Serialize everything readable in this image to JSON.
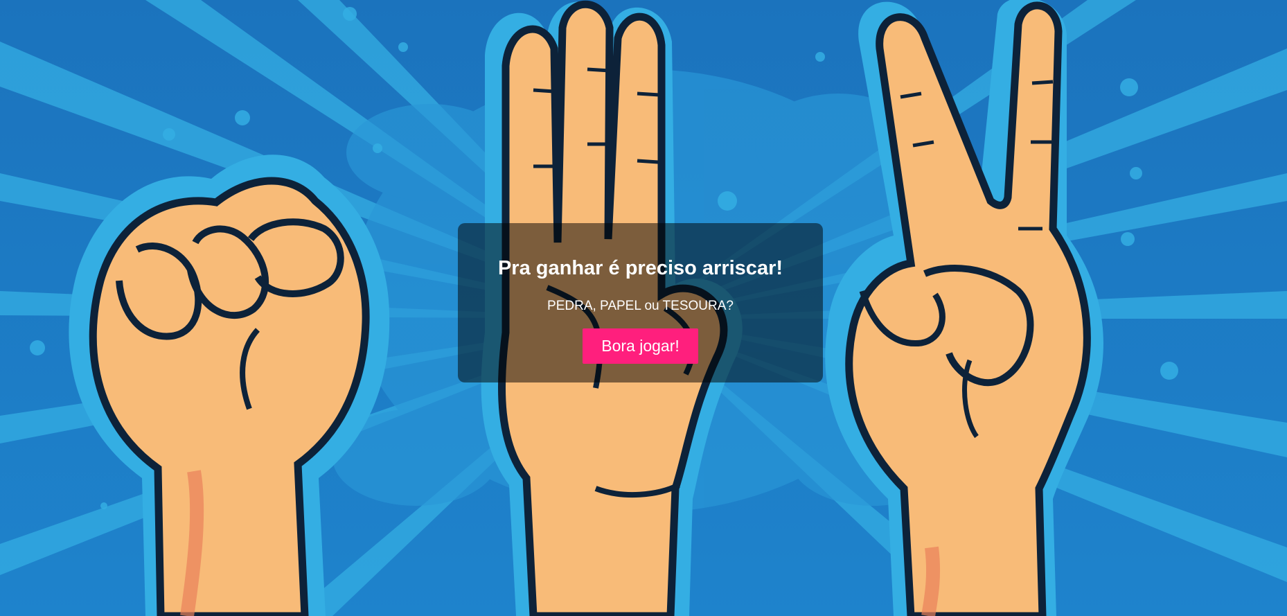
{
  "hero": {
    "background_icon_names": [
      "rock-fist-icon",
      "paper-hand-icon",
      "scissors-hand-icon"
    ],
    "colors": {
      "background": "#1f7fc8",
      "accent_blue": "#34aee3",
      "skin": "#f8bb78",
      "skin_shadow": "#e9805a",
      "outline": "#0d2239",
      "button": "#ff1f7d"
    }
  },
  "overlay": {
    "title": "Pra ganhar é preciso arriscar!",
    "subtitle": "PEDRA, PAPEL ou TESOURA?",
    "button_label": "Bora jogar!"
  }
}
